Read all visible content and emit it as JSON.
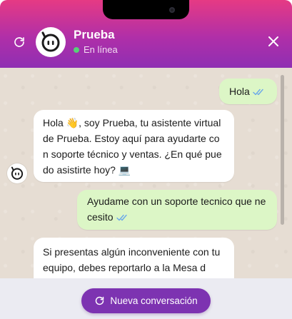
{
  "header": {
    "bot_name": "Prueba",
    "status_text": "En línea",
    "refresh_icon": "refresh-icon",
    "close_icon": "close-icon",
    "gradient_colors": [
      "#e63a84",
      "#8f2fb3"
    ]
  },
  "messages": [
    {
      "sender": "user",
      "text": "Hola",
      "status_icon": "double-check-icon"
    },
    {
      "sender": "bot",
      "text": "Hola 👋, soy Prueba, tu asistente virtual de Prueba. Estoy aquí para ayudarte con soporte técnico y ventas. ¿En qué puedo asistirte hoy? 💻"
    },
    {
      "sender": "user",
      "text": "Ayudame con un soporte tecnico que necesito",
      "status_icon": "double-check-icon"
    },
    {
      "sender": "bot",
      "text": "Si presentas algún inconveniente con tu equipo, debes reportarlo a la Mesa d"
    }
  ],
  "footer": {
    "new_conversation_label": "Nueva conversación"
  },
  "colors": {
    "accent": "#7d33b1",
    "user_bubble": "#dcf6c6",
    "bot_bubble": "#ffffff",
    "chat_background": "#e6ddd3",
    "online_dot": "#58d078",
    "read_ticks": "#6aa7ea"
  }
}
